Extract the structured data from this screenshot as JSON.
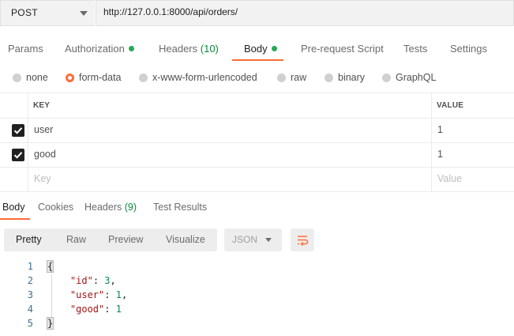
{
  "request": {
    "method": "POST",
    "url": "http://127.0.0.1:8000/api/orders/"
  },
  "request_tabs": {
    "params": "Params",
    "authorization": "Authorization",
    "headers": "Headers",
    "headers_count": "(10)",
    "body": "Body",
    "prerequest": "Pre-request Script",
    "tests": "Tests",
    "settings": "Settings"
  },
  "body_types": {
    "none": "none",
    "form_data": "form-data",
    "urlencoded": "x-www-form-urlencoded",
    "raw": "raw",
    "binary": "binary",
    "graphql": "GraphQL",
    "selected": "form-data"
  },
  "form_table": {
    "headers": {
      "key": "KEY",
      "value": "VALUE"
    },
    "rows": [
      {
        "key": "user",
        "value": "1",
        "checked": true
      },
      {
        "key": "good",
        "value": "1",
        "checked": true
      }
    ],
    "placeholder": {
      "key": "Key",
      "value": "Value"
    }
  },
  "response_tabs": {
    "body": "Body",
    "cookies": "Cookies",
    "headers": "Headers",
    "headers_count": "(9)",
    "test_results": "Test Results"
  },
  "view_toolbar": {
    "pretty": "Pretty",
    "raw": "Raw",
    "preview": "Preview",
    "visualize": "Visualize",
    "format": "JSON"
  },
  "response_code": {
    "line_numbers": [
      "1",
      "2",
      "3",
      "4",
      "5"
    ],
    "open_brace": "{",
    "close_brace": "}",
    "fields": [
      {
        "key": "\"id\"",
        "value": "3",
        "trail": ","
      },
      {
        "key": "\"user\"",
        "value": "1",
        "trail": ","
      },
      {
        "key": "\"good\"",
        "value": "1",
        "trail": ""
      }
    ]
  },
  "colors": {
    "accent": "#ff6c37",
    "status_dot": "#26a955",
    "json_key": "#a31515",
    "json_number": "#09885a"
  }
}
